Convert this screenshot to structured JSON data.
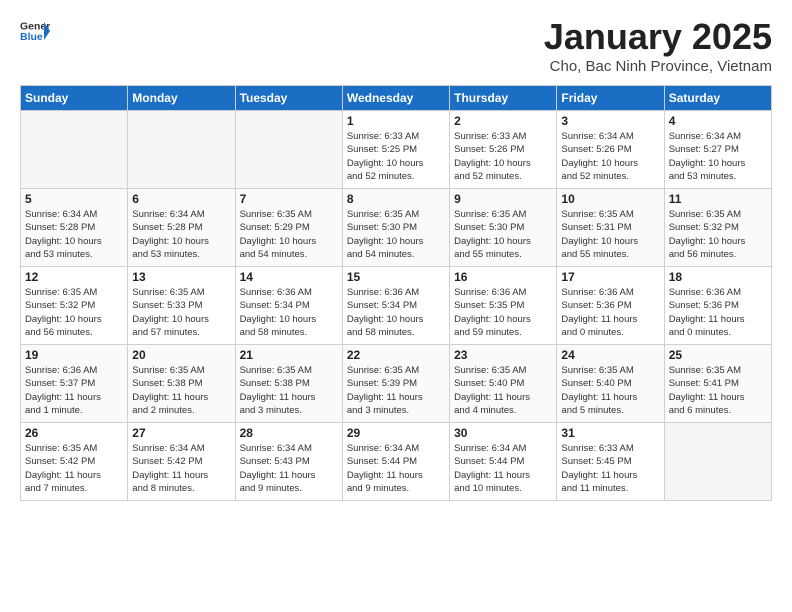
{
  "header": {
    "logo_general": "General",
    "logo_blue": "Blue",
    "title": "January 2025",
    "subtitle": "Cho, Bac Ninh Province, Vietnam"
  },
  "weekdays": [
    "Sunday",
    "Monday",
    "Tuesday",
    "Wednesday",
    "Thursday",
    "Friday",
    "Saturday"
  ],
  "weeks": [
    [
      {
        "day": "",
        "detail": ""
      },
      {
        "day": "",
        "detail": ""
      },
      {
        "day": "",
        "detail": ""
      },
      {
        "day": "1",
        "detail": "Sunrise: 6:33 AM\nSunset: 5:25 PM\nDaylight: 10 hours\nand 52 minutes."
      },
      {
        "day": "2",
        "detail": "Sunrise: 6:33 AM\nSunset: 5:26 PM\nDaylight: 10 hours\nand 52 minutes."
      },
      {
        "day": "3",
        "detail": "Sunrise: 6:34 AM\nSunset: 5:26 PM\nDaylight: 10 hours\nand 52 minutes."
      },
      {
        "day": "4",
        "detail": "Sunrise: 6:34 AM\nSunset: 5:27 PM\nDaylight: 10 hours\nand 53 minutes."
      }
    ],
    [
      {
        "day": "5",
        "detail": "Sunrise: 6:34 AM\nSunset: 5:28 PM\nDaylight: 10 hours\nand 53 minutes."
      },
      {
        "day": "6",
        "detail": "Sunrise: 6:34 AM\nSunset: 5:28 PM\nDaylight: 10 hours\nand 53 minutes."
      },
      {
        "day": "7",
        "detail": "Sunrise: 6:35 AM\nSunset: 5:29 PM\nDaylight: 10 hours\nand 54 minutes."
      },
      {
        "day": "8",
        "detail": "Sunrise: 6:35 AM\nSunset: 5:30 PM\nDaylight: 10 hours\nand 54 minutes."
      },
      {
        "day": "9",
        "detail": "Sunrise: 6:35 AM\nSunset: 5:30 PM\nDaylight: 10 hours\nand 55 minutes."
      },
      {
        "day": "10",
        "detail": "Sunrise: 6:35 AM\nSunset: 5:31 PM\nDaylight: 10 hours\nand 55 minutes."
      },
      {
        "day": "11",
        "detail": "Sunrise: 6:35 AM\nSunset: 5:32 PM\nDaylight: 10 hours\nand 56 minutes."
      }
    ],
    [
      {
        "day": "12",
        "detail": "Sunrise: 6:35 AM\nSunset: 5:32 PM\nDaylight: 10 hours\nand 56 minutes."
      },
      {
        "day": "13",
        "detail": "Sunrise: 6:35 AM\nSunset: 5:33 PM\nDaylight: 10 hours\nand 57 minutes."
      },
      {
        "day": "14",
        "detail": "Sunrise: 6:36 AM\nSunset: 5:34 PM\nDaylight: 10 hours\nand 58 minutes."
      },
      {
        "day": "15",
        "detail": "Sunrise: 6:36 AM\nSunset: 5:34 PM\nDaylight: 10 hours\nand 58 minutes."
      },
      {
        "day": "16",
        "detail": "Sunrise: 6:36 AM\nSunset: 5:35 PM\nDaylight: 10 hours\nand 59 minutes."
      },
      {
        "day": "17",
        "detail": "Sunrise: 6:36 AM\nSunset: 5:36 PM\nDaylight: 11 hours\nand 0 minutes."
      },
      {
        "day": "18",
        "detail": "Sunrise: 6:36 AM\nSunset: 5:36 PM\nDaylight: 11 hours\nand 0 minutes."
      }
    ],
    [
      {
        "day": "19",
        "detail": "Sunrise: 6:36 AM\nSunset: 5:37 PM\nDaylight: 11 hours\nand 1 minute."
      },
      {
        "day": "20",
        "detail": "Sunrise: 6:35 AM\nSunset: 5:38 PM\nDaylight: 11 hours\nand 2 minutes."
      },
      {
        "day": "21",
        "detail": "Sunrise: 6:35 AM\nSunset: 5:38 PM\nDaylight: 11 hours\nand 3 minutes."
      },
      {
        "day": "22",
        "detail": "Sunrise: 6:35 AM\nSunset: 5:39 PM\nDaylight: 11 hours\nand 3 minutes."
      },
      {
        "day": "23",
        "detail": "Sunrise: 6:35 AM\nSunset: 5:40 PM\nDaylight: 11 hours\nand 4 minutes."
      },
      {
        "day": "24",
        "detail": "Sunrise: 6:35 AM\nSunset: 5:40 PM\nDaylight: 11 hours\nand 5 minutes."
      },
      {
        "day": "25",
        "detail": "Sunrise: 6:35 AM\nSunset: 5:41 PM\nDaylight: 11 hours\nand 6 minutes."
      }
    ],
    [
      {
        "day": "26",
        "detail": "Sunrise: 6:35 AM\nSunset: 5:42 PM\nDaylight: 11 hours\nand 7 minutes."
      },
      {
        "day": "27",
        "detail": "Sunrise: 6:34 AM\nSunset: 5:42 PM\nDaylight: 11 hours\nand 8 minutes."
      },
      {
        "day": "28",
        "detail": "Sunrise: 6:34 AM\nSunset: 5:43 PM\nDaylight: 11 hours\nand 9 minutes."
      },
      {
        "day": "29",
        "detail": "Sunrise: 6:34 AM\nSunset: 5:44 PM\nDaylight: 11 hours\nand 9 minutes."
      },
      {
        "day": "30",
        "detail": "Sunrise: 6:34 AM\nSunset: 5:44 PM\nDaylight: 11 hours\nand 10 minutes."
      },
      {
        "day": "31",
        "detail": "Sunrise: 6:33 AM\nSunset: 5:45 PM\nDaylight: 11 hours\nand 11 minutes."
      },
      {
        "day": "",
        "detail": ""
      }
    ]
  ]
}
